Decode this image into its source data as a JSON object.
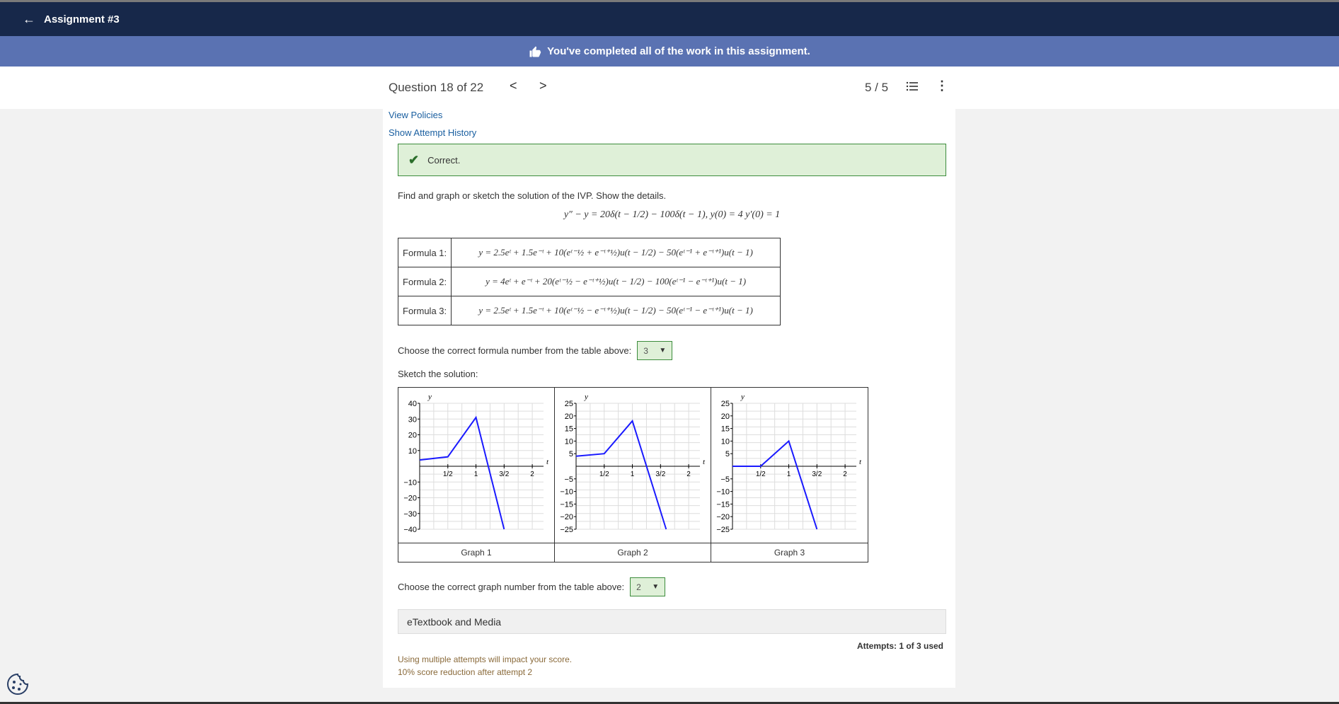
{
  "header": {
    "back_icon": "arrow-left-icon",
    "title": "Assignment #3"
  },
  "banner": {
    "icon": "thumbs-up-icon",
    "text": "You've completed all of the work in this assignment."
  },
  "question": {
    "title": "Question 18 of 22",
    "prev": "<",
    "next": ">",
    "score": "5 / 5",
    "list_icon": "list-icon",
    "more_icon": "more-vertical-icon"
  },
  "links": {
    "view_policies": "View Policies",
    "show_history": "Show Attempt History"
  },
  "status": {
    "icon": "check-icon",
    "text": "Correct.",
    "color": "#dff0d8"
  },
  "problem": {
    "text": "Find and graph or sketch the solution of the IVP. Show the details.",
    "equation": "y″ − y = 20δ(t − 1/2) − 100δ(t − 1),  y(0) = 4  y′(0) = 1"
  },
  "formulas": [
    {
      "label": "Formula 1:",
      "expr": "y = 2.5eᵗ + 1.5e⁻ᵗ + 10(eᵗ⁻½ + e⁻ᵗ⁺½)u(t − 1/2) − 50(eᵗ⁻¹ + e⁻ᵗ⁺¹)u(t − 1)"
    },
    {
      "label": "Formula 2:",
      "expr": "y = 4eᵗ + e⁻ᵗ + 20(eᵗ⁻½ − e⁻ᵗ⁺½)u(t − 1/2) − 100(eᵗ⁻¹ − e⁻ᵗ⁺¹)u(t − 1)"
    },
    {
      "label": "Formula 3:",
      "expr": "y = 2.5eᵗ + 1.5e⁻ᵗ + 10(eᵗ⁻½ − e⁻ᵗ⁺½)u(t − 1/2) − 50(eᵗ⁻¹ − e⁻ᵗ⁺¹)u(t − 1)"
    }
  ],
  "formula_choice": {
    "label": "Choose the correct formula number from the table above:",
    "value": "3"
  },
  "sketch_label": "Sketch the solution:",
  "graph_choice": {
    "label": "Choose the correct graph number from the table above:",
    "value": "2"
  },
  "etextbook": "eTextbook and Media",
  "attempts": "Attempts: 1 of 3 used",
  "notes": [
    "Using multiple attempts will impact your score.",
    "10% score reduction after attempt 2"
  ],
  "cookie_icon": "cookie-icon",
  "chart_data": [
    {
      "type": "line",
      "caption": "Graph 1",
      "xlabel": "t",
      "ylabel": "y",
      "xlim": [
        0,
        2.2
      ],
      "ylim": [
        -40,
        40
      ],
      "yticks": [
        40,
        30,
        20,
        10,
        -10,
        -20,
        -30,
        -40
      ],
      "xticks": [
        "1/2",
        "1",
        "3/2",
        "2"
      ],
      "x": [
        0,
        0.5,
        1,
        1.5
      ],
      "y": [
        4,
        6,
        31,
        -40
      ],
      "color": "#1a1aff"
    },
    {
      "type": "line",
      "caption": "Graph 2",
      "xlabel": "t",
      "ylabel": "y",
      "xlim": [
        0,
        2.2
      ],
      "ylim": [
        -25,
        25
      ],
      "yticks": [
        25,
        20,
        15,
        10,
        5,
        -5,
        -10,
        -15,
        -20,
        -25
      ],
      "xticks": [
        "1/2",
        "1",
        "3/2",
        "2"
      ],
      "x": [
        0,
        0.5,
        1,
        1.6
      ],
      "y": [
        4,
        5,
        18,
        -25
      ],
      "color": "#1a1aff"
    },
    {
      "type": "line",
      "caption": "Graph 3",
      "xlabel": "t",
      "ylabel": "y",
      "xlim": [
        0,
        2.2
      ],
      "ylim": [
        -25,
        25
      ],
      "yticks": [
        25,
        20,
        15,
        10,
        5,
        -5,
        -10,
        -15,
        -20,
        -25
      ],
      "xticks": [
        "1/2",
        "1",
        "3/2",
        "2"
      ],
      "x": [
        0,
        0.5,
        1,
        1.5
      ],
      "y": [
        0,
        0,
        10,
        -25
      ],
      "color": "#1a1aff"
    }
  ]
}
